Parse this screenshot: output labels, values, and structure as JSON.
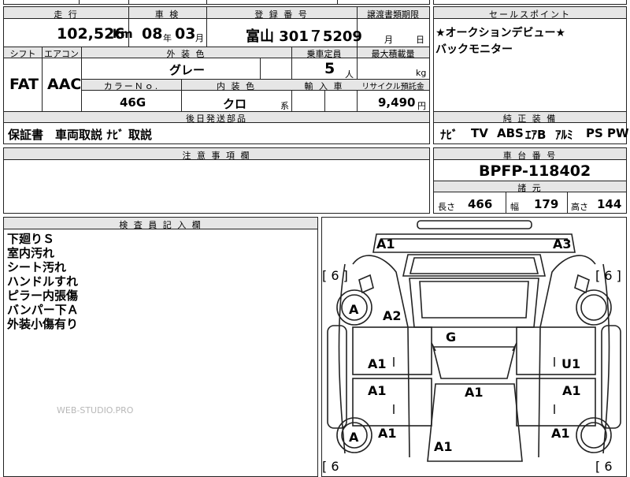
{
  "top_fragment": "嘗…",
  "mileage": {
    "label": "走 行",
    "value": "102,526",
    "unit": "km"
  },
  "inspection": {
    "label": "車 検",
    "year": "08",
    "year_unit": "年",
    "month": "03",
    "month_unit": "月"
  },
  "registration": {
    "label": "登 録 番 号",
    "value": "富山 301７5209"
  },
  "transfer_deadline": {
    "label": "譲渡書類期限",
    "month_unit": "月",
    "day_unit": "日"
  },
  "sales_points": {
    "label": "セールスポイント",
    "lines": [
      "★オークションデビュー★",
      "バックモニター"
    ]
  },
  "shift": {
    "label": "シフト",
    "value": "FAT"
  },
  "aircon": {
    "label": "エアコン",
    "value": "AAC"
  },
  "exterior_color": {
    "label": "外 装 色",
    "value": "グレー"
  },
  "capacity": {
    "label": "乗車定員",
    "value": "5",
    "unit": "人"
  },
  "max_load": {
    "label": "最大積載量",
    "unit": "kg"
  },
  "color_no": {
    "label": "カラーＮｏ.",
    "value": "46G"
  },
  "interior_color": {
    "label": "内 装 色",
    "value": "クロ",
    "suffix": "系"
  },
  "import": {
    "label": "輸 入 車"
  },
  "recycle": {
    "label": "リサイクル預託金",
    "value": "9,490",
    "unit": "円"
  },
  "later_parts": {
    "label": "後日発送部品",
    "value": "保証書　車両取説 ﾅﾋﾞ 取説"
  },
  "equipment": {
    "label": "純 正 装 備",
    "items": [
      "ﾅﾋﾞ",
      "TV",
      "ABS",
      "ｴｱB",
      "ｱﾙﾐ",
      "PS",
      "PW"
    ]
  },
  "caution": {
    "label": "注 意 事 項 欄"
  },
  "chassis": {
    "label": "車 台 番 号",
    "value": "BPFP-118402"
  },
  "specs": {
    "label": "諸 元",
    "length_label": "長さ",
    "length": "466",
    "width_label": "幅",
    "width": "179",
    "height_label": "高さ",
    "height": "144"
  },
  "inspector": {
    "label": "検 査 員 記 入 欄",
    "notes": [
      "下廻りＳ",
      "室内汚れ",
      "シート汚れ",
      "ハンドルすれ",
      "ピラー内張傷",
      "バンパー下Ａ",
      "外装小傷有り"
    ]
  },
  "watermark": "WEB-STUDIO.PRO",
  "diagram": {
    "marks": {
      "front_left": "A1",
      "front_right": "A3",
      "wheel_fl": "A",
      "fender_fl": "A2",
      "roof": "G",
      "door_fl": "A1",
      "door_fr": "U1",
      "door_rl": "A1",
      "door_rr": "A1",
      "hood_center": "A1",
      "wheel_rl": "A",
      "quarter_rl": "A1",
      "quarter_rr": "A1",
      "rear_center": "A1"
    },
    "tire_depth": [
      "[ 6 ]",
      "[ 6 ]",
      "[ 6",
      "[ 6"
    ]
  }
}
